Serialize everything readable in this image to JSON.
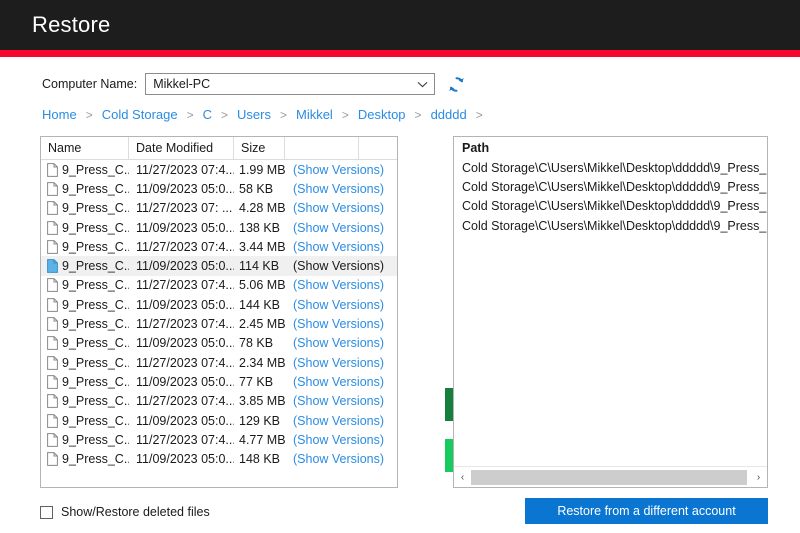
{
  "window": {
    "title": "Restore",
    "accent_color": "#f5072f",
    "titlebar_color": "#1d1d1d"
  },
  "computer": {
    "label": "Computer Name:",
    "selected": "Mikkel-PC",
    "options": [
      "Mikkel-PC"
    ],
    "refresh_icon": "refresh-icon",
    "chevron": "⌄"
  },
  "breadcrumb": {
    "separator": ">",
    "items": [
      {
        "label": "Home"
      },
      {
        "label": "Cold Storage"
      },
      {
        "label": "C"
      },
      {
        "label": "Users"
      },
      {
        "label": "Mikkel"
      },
      {
        "label": "Desktop"
      },
      {
        "label": "ddddd"
      }
    ],
    "link_color": "#2b8ce3"
  },
  "file_list": {
    "columns": [
      "Name",
      "Date Modified",
      "Size",
      ""
    ],
    "show_versions_label": "(Show Versions)",
    "rows": [
      {
        "name": "9_Press_C...",
        "date": "11/27/2023 07:4...",
        "size": "1.99 MB",
        "versions": "(Show Versions)",
        "selected": false
      },
      {
        "name": "9_Press_C...",
        "date": "11/09/2023 05:0...",
        "size": "58 KB",
        "versions": "(Show Versions)",
        "selected": false
      },
      {
        "name": "9_Press_C...",
        "date": "11/27/2023 07:  ...",
        "size": "4.28 MB",
        "versions": "(Show Versions)",
        "selected": false
      },
      {
        "name": "9_Press_C...",
        "date": "11/09/2023 05:0...",
        "size": "138 KB",
        "versions": "(Show Versions)",
        "selected": false
      },
      {
        "name": "9_Press_C...",
        "date": "11/27/2023 07:4...",
        "size": "3.44 MB",
        "versions": "(Show Versions)",
        "selected": false
      },
      {
        "name": "9_Press_C...",
        "date": "11/09/2023 05:0...",
        "size": "114 KB",
        "versions": "(Show Versions)",
        "selected": true
      },
      {
        "name": "9_Press_C...",
        "date": "11/27/2023 07:4...",
        "size": "5.06 MB",
        "versions": "(Show Versions)",
        "selected": false
      },
      {
        "name": "9_Press_C...",
        "date": "11/09/2023 05:0...",
        "size": "144 KB",
        "versions": "(Show Versions)",
        "selected": false
      },
      {
        "name": "9_Press_C...",
        "date": "11/27/2023 07:4...",
        "size": "2.45 MB",
        "versions": "(Show Versions)",
        "selected": false
      },
      {
        "name": "9_Press_C...",
        "date": "11/09/2023 05:0...",
        "size": "78 KB",
        "versions": "(Show Versions)",
        "selected": false
      },
      {
        "name": "9_Press_C...",
        "date": "11/27/2023 07:4...",
        "size": "2.34 MB",
        "versions": "(Show Versions)",
        "selected": false
      },
      {
        "name": "9_Press_C...",
        "date": "11/09/2023 05:0...",
        "size": "77 KB",
        "versions": "(Show Versions)",
        "selected": false
      },
      {
        "name": "9_Press_C...",
        "date": "11/27/2023 07:4...",
        "size": "3.85 MB",
        "versions": "(Show Versions)",
        "selected": false
      },
      {
        "name": "9_Press_C...",
        "date": "11/09/2023 05:0...",
        "size": "129 KB",
        "versions": "(Show Versions)",
        "selected": false
      },
      {
        "name": "9_Press_C...",
        "date": "11/27/2023 07:4...",
        "size": "4.77 MB",
        "versions": "(Show Versions)",
        "selected": false
      },
      {
        "name": "9_Press_C...",
        "date": "11/09/2023 05:0...",
        "size": "148 KB",
        "versions": "(Show Versions)",
        "selected": false
      }
    ]
  },
  "path_list": {
    "header": "Path",
    "rows": [
      {
        "path": "Cold Storage\\C\\Users\\Mikkel\\Desktop\\ddddd\\9_Press_..."
      },
      {
        "path": "Cold Storage\\C\\Users\\Mikkel\\Desktop\\ddddd\\9_Press_..."
      },
      {
        "path": "Cold Storage\\C\\Users\\Mikkel\\Desktop\\ddddd\\9_Press_..."
      },
      {
        "path": "Cold Storage\\C\\Users\\Mikkel\\Desktop\\ddddd\\9_Press_..."
      }
    ],
    "scrollbar": {
      "left_arrow": "‹",
      "right_arrow": "›"
    }
  },
  "transfer": {
    "add_label": ">>",
    "remove_label": "<<",
    "add_color": "#15803d",
    "remove_color": "#16cc60"
  },
  "bottom": {
    "checkbox_label": "Show/Restore deleted files",
    "checkbox_checked": false,
    "restore_button_label": "Restore from a different account",
    "restore_button_color": "#0a76d2"
  }
}
